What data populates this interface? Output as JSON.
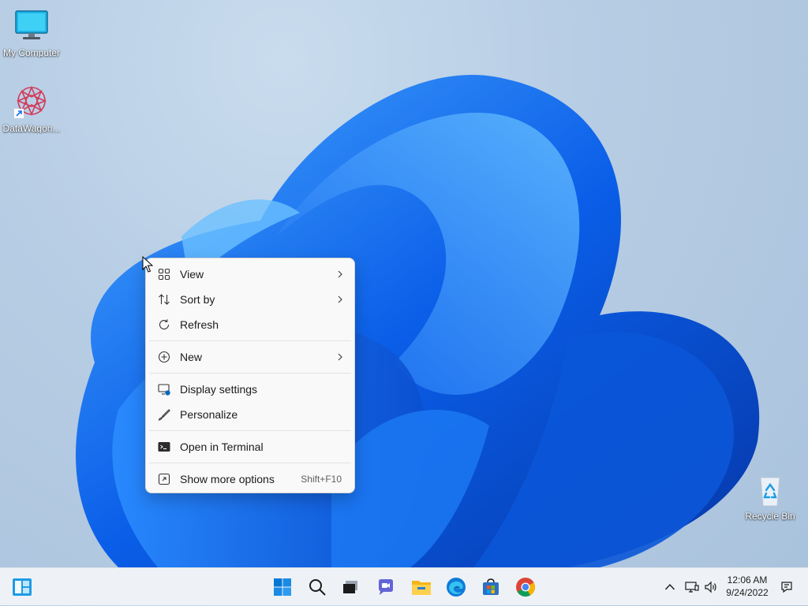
{
  "desktop": {
    "icons": [
      {
        "label": "My Computer",
        "icon": "monitor-icon"
      },
      {
        "label": "DataWagon...",
        "icon": "datawagon-icon"
      },
      {
        "label": "Recycle Bin",
        "icon": "recycle-bin-icon"
      }
    ]
  },
  "context_menu": {
    "items": [
      {
        "label": "View",
        "icon": "grid-view-icon",
        "submenu": true
      },
      {
        "label": "Sort by",
        "icon": "sort-icon",
        "submenu": true
      },
      {
        "label": "Refresh",
        "icon": "refresh-icon"
      },
      {
        "label": "New",
        "icon": "plus-circle-icon",
        "submenu": true
      },
      {
        "label": "Display settings",
        "icon": "display-settings-icon"
      },
      {
        "label": "Personalize",
        "icon": "brush-icon"
      },
      {
        "label": "Open in Terminal",
        "icon": "terminal-icon"
      },
      {
        "label": "Show more options",
        "icon": "more-options-icon",
        "shortcut": "Shift+F10"
      }
    ]
  },
  "taskbar": {
    "clock": {
      "time": "12:06 AM",
      "date": "9/24/2022"
    },
    "apps": [
      "widgets-icon",
      "start-icon",
      "search-icon",
      "task-view-icon",
      "chat-icon",
      "file-explorer-icon",
      "edge-icon",
      "store-icon",
      "chrome-icon"
    ],
    "tray": [
      "chevron-up-icon",
      "network-icon",
      "volume-icon",
      "notification-icon"
    ]
  },
  "colors": {
    "accent": "#0067c0",
    "menu_bg": "#f9f9f9",
    "taskbar_bg": "#eef2f6"
  }
}
